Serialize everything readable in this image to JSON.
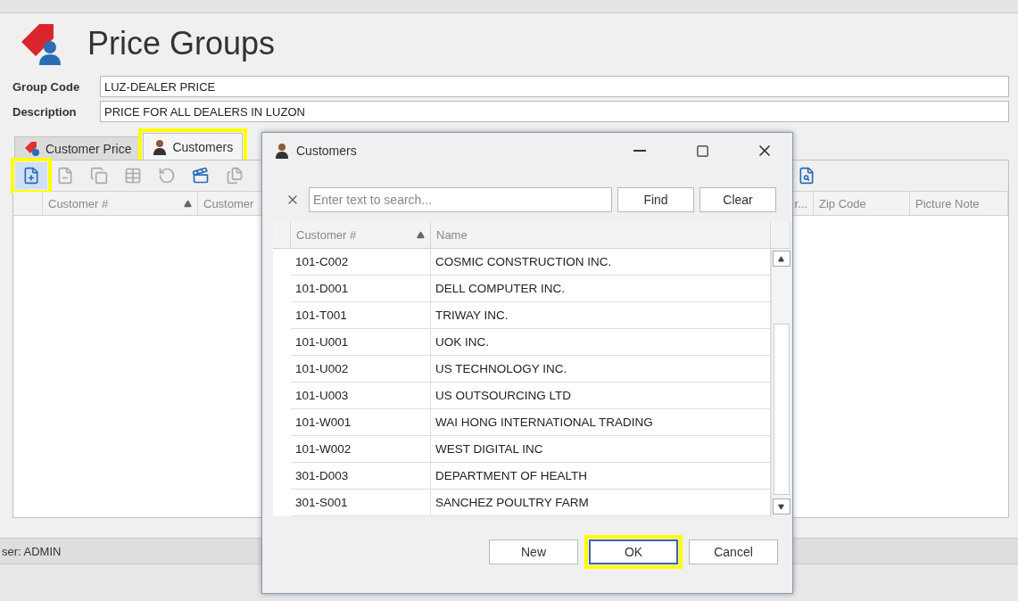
{
  "window": {
    "title": "Price Groups"
  },
  "fields": [
    {
      "label": "Group Code",
      "value": "LUZ-DEALER PRICE"
    },
    {
      "label": "Description",
      "value": "PRICE FOR ALL DEALERS IN LUZON"
    }
  ],
  "tabs": [
    {
      "label": "Customer Price",
      "selected": false,
      "highlighted": false,
      "kind": "price"
    },
    {
      "label": "Customers",
      "selected": true,
      "highlighted": true,
      "kind": "person"
    }
  ],
  "toolbar": [
    {
      "kind": "add",
      "disabled": false,
      "highlighted": true
    },
    {
      "kind": "remove",
      "disabled": true,
      "highlighted": false
    },
    {
      "kind": "copy",
      "disabled": true,
      "highlighted": false
    },
    {
      "kind": "grid",
      "disabled": true,
      "highlighted": false
    },
    {
      "kind": "refresh",
      "disabled": true,
      "highlighted": false
    },
    {
      "kind": "film",
      "disabled": false,
      "highlighted": false
    },
    {
      "kind": "window",
      "disabled": true,
      "highlighted": false
    },
    {
      "kind": "search",
      "disabled": false,
      "highlighted": false
    }
  ],
  "grid": {
    "columns": [
      {
        "label": "Customer #",
        "sorted": true
      },
      {
        "label": "Customer"
      },
      {
        "label": "r...",
        "sorted": false
      },
      {
        "label": "Zip Code",
        "sorted": false
      },
      {
        "label": "Picture Note",
        "sorted": false
      }
    ]
  },
  "status_bar": {
    "user": "ser: ADMIN"
  },
  "dialog": {
    "title": "Customers",
    "search": {
      "placeholder": "Enter text to search...",
      "find": "Find",
      "clear": "Clear"
    },
    "columns": [
      {
        "label": "Customer #",
        "sorted": true
      },
      {
        "label": "Name",
        "sorted": false
      }
    ],
    "rows": [
      {
        "code": "101-C002",
        "name": "COSMIC CONSTRUCTION INC."
      },
      {
        "code": "101-D001",
        "name": "DELL COMPUTER INC."
      },
      {
        "code": "101-T001",
        "name": "TRIWAY INC."
      },
      {
        "code": "101-U001",
        "name": "UOK  INC."
      },
      {
        "code": "101-U002",
        "name": "US TECHNOLOGY  INC."
      },
      {
        "code": "101-U003",
        "name": "US OUTSOURCING LTD"
      },
      {
        "code": "101-W001",
        "name": "WAI HONG INTERNATIONAL TRADING"
      },
      {
        "code": "101-W002",
        "name": "WEST DIGITAL INC"
      },
      {
        "code": "301-D003",
        "name": "DEPARTMENT OF HEALTH"
      },
      {
        "code": "301-S001",
        "name": "SANCHEZ POULTRY FARM"
      }
    ],
    "buttons": [
      {
        "label": "New",
        "highlighted": false
      },
      {
        "label": "OK",
        "highlighted": true
      },
      {
        "label": "Cancel",
        "highlighted": false
      }
    ]
  }
}
